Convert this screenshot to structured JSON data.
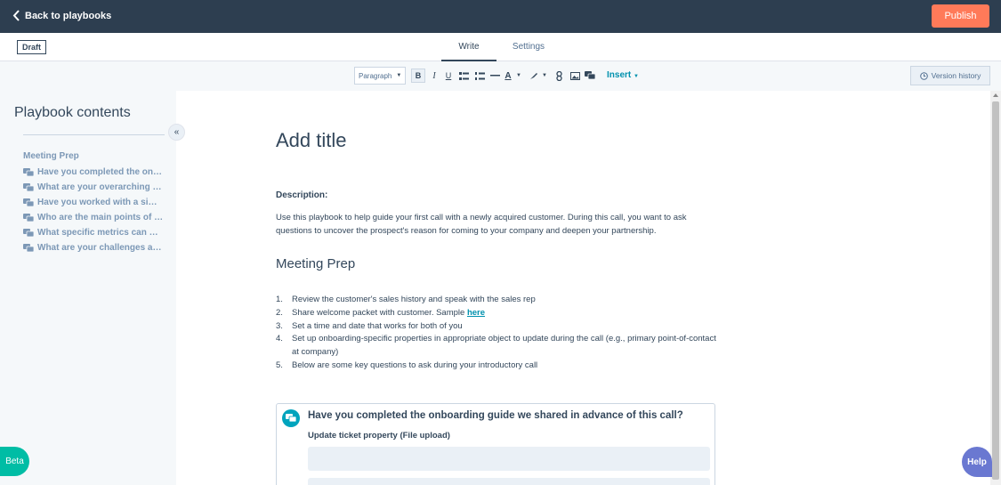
{
  "header": {
    "back_label": "Back to playbooks",
    "publish_label": "Publish"
  },
  "tabs": {
    "draft_badge": "Draft",
    "write": "Write",
    "settings": "Settings"
  },
  "toolbar": {
    "paragraph_select": "Paragraph",
    "bold": "B",
    "italic": "I",
    "underline": "U",
    "font_color": "A",
    "insert_label": "Insert",
    "version_history_label": "Version history",
    "icons": [
      "bold-icon",
      "italic-icon",
      "underline-icon",
      "bulleted-list-icon",
      "numbered-list-icon",
      "horizontal-rule-icon",
      "font-color-icon",
      "highlight-icon",
      "link-icon",
      "image-icon",
      "question-icon"
    ]
  },
  "sidebar": {
    "title": "Playbook contents",
    "section": "Meeting Prep",
    "items": [
      {
        "label": "Have you completed the onboarding guide we shared in advance of this call?"
      },
      {
        "label": "What are your overarching goals?"
      },
      {
        "label": "Have you worked with a similar company before?"
      },
      {
        "label": "Who are the main points of contact?"
      },
      {
        "label": "What specific metrics can we track?"
      },
      {
        "label": "What are your challenges and pain points?"
      }
    ]
  },
  "document": {
    "title_placeholder": "Add title",
    "description_label": "Description:",
    "description_text": "Use this playbook to help guide your first call with a newly acquired customer. During this call, you want to ask questions to uncover the prospect's reason for coming to your company and deepen your partnership.",
    "section_heading": "Meeting Prep",
    "steps": [
      {
        "num": "1.",
        "text": "Review the customer's sales history and speak with the sales rep"
      },
      {
        "num": "2.",
        "text": "Share welcome packet with customer. Sample ",
        "link": "here"
      },
      {
        "num": "3.",
        "text": "Set a time and date that works for both of you"
      },
      {
        "num": "4.",
        "text": "Set up onboarding-specific properties in appropriate object to update during the call (e.g., primary point-of-contact at company)"
      },
      {
        "num": "5.",
        "text": "Below are some key questions to ask during your introductory call"
      }
    ],
    "question_card": {
      "title": "Have you completed the onboarding guide we shared in advance of this call?",
      "subtitle": "Update ticket property (File upload)"
    }
  },
  "floating": {
    "beta_label": "Beta",
    "help_label": "Help"
  },
  "colors": {
    "topbar": "#2d3e50",
    "publish": "#ff7a59",
    "accent_link": "#0091ae",
    "beta": "#00bda5",
    "help": "#6a78d1",
    "question_icon": "#00a4bd"
  }
}
